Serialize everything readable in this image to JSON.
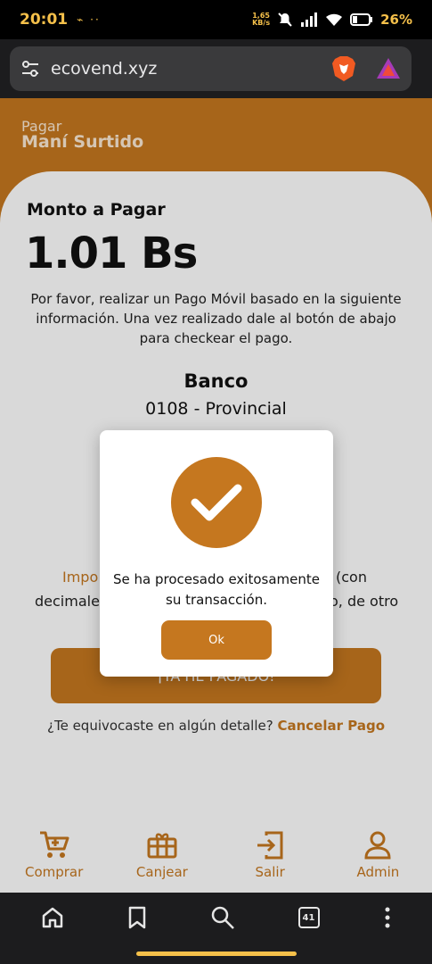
{
  "status_bar": {
    "time": "20:01",
    "extra": "•",
    "kbs_top": "1,65",
    "kbs_bottom": "KB/s",
    "battery": "26%"
  },
  "browser": {
    "url": "ecovend.xyz",
    "tab_count": "41"
  },
  "header": {
    "label": "Pagar",
    "product": "Maní Surtido"
  },
  "payment": {
    "monto_label": "Monto a Pagar",
    "monto_value": "1.01 Bs",
    "instructions": "Por favor, realizar un Pago Móvil basado en la siguiente información. Una vez realizado dale al botón de abajo para checkear el pago.",
    "banco_label": "Banco",
    "banco_value": "0108 - Provincial",
    "peek_left_1": "Impo",
    "peek_right_1": "(con",
    "peek_left_2": "decimale",
    "peek_right_2": "o, de otro",
    "pay_button": "¡YA HE PAGADO!",
    "error_text": "¿Te equivocaste en algún detalle?",
    "cancel_link": "Cancelar Pago"
  },
  "bottom_nav": [
    {
      "label": "Comprar",
      "icon": "cart-icon"
    },
    {
      "label": "Canjear",
      "icon": "gift-icon"
    },
    {
      "label": "Salir",
      "icon": "logout-icon"
    },
    {
      "label": "Admin",
      "icon": "user-icon"
    }
  ],
  "modal": {
    "message": "Se ha procesado exitosamente su transacción.",
    "ok_label": "Ok"
  },
  "colors": {
    "accent": "#c5771f",
    "status_yellow": "#f5c04a"
  }
}
